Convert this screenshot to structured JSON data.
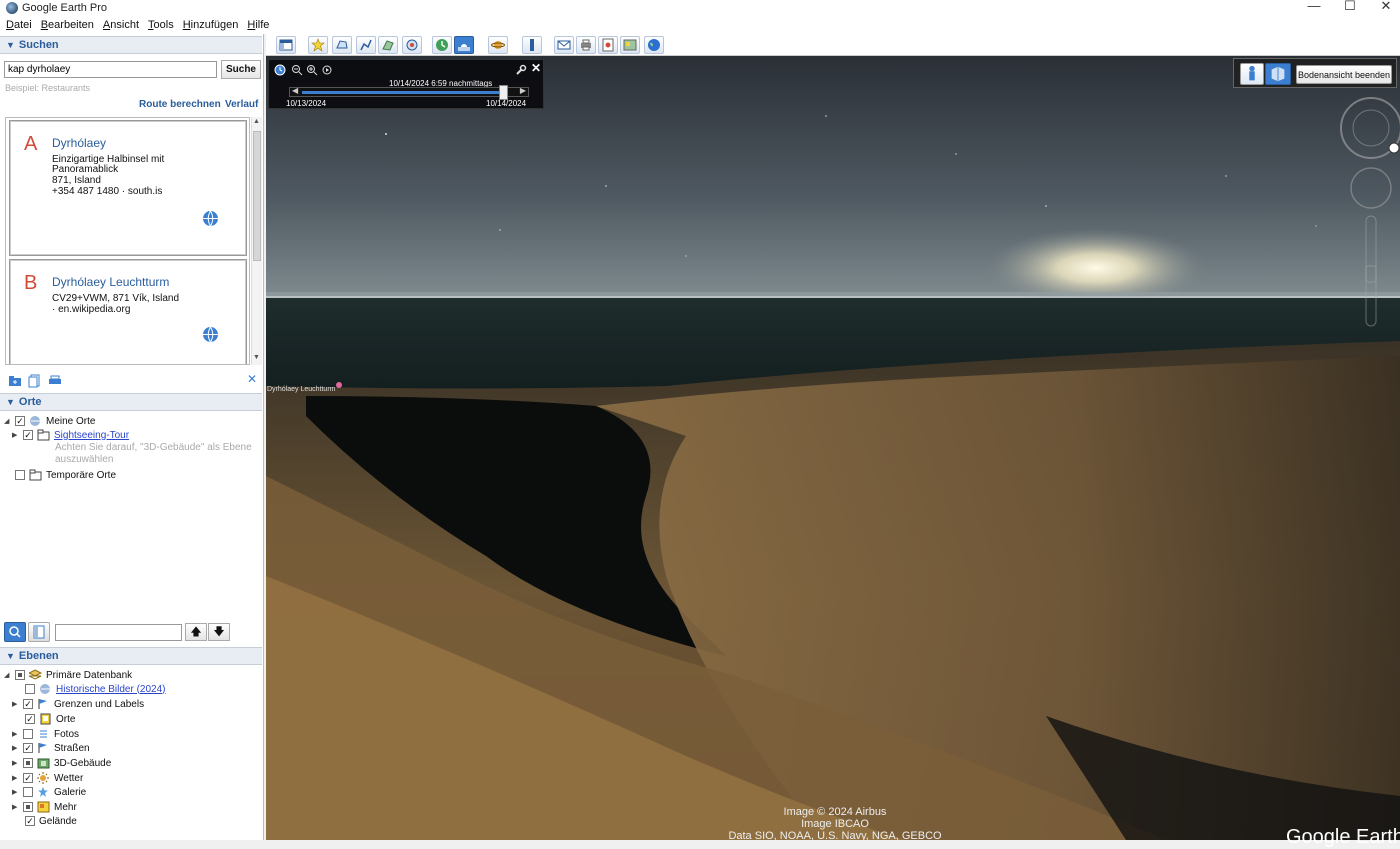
{
  "window": {
    "title": "Google Earth Pro",
    "minimize": "—",
    "maximize": "☐",
    "close": "✕"
  },
  "menu": [
    "Datei",
    "Bearbeiten",
    "Ansicht",
    "Tools",
    "Hinzufügen",
    "Hilfe"
  ],
  "toolbar": {
    "buttons": [
      "sidebar-toggle-icon",
      "placemark-icon",
      "polygon-icon",
      "path-icon",
      "image-overlay-icon",
      "record-tour-icon",
      "historical-imagery-icon",
      "sunlight-icon",
      "planets-icon",
      "ruler-icon",
      "email-icon",
      "print-icon",
      "save-image-icon",
      "google-maps-icon",
      "earth-icon"
    ]
  },
  "search": {
    "header": "Suchen",
    "query": "kap dyrholaey",
    "button": "Suche",
    "example": "Beispiel: Restaurants",
    "route_link": "Route berechnen",
    "history_link": "Verlauf",
    "results": [
      {
        "letter": "A",
        "name": "Dyrhólaey",
        "lines": [
          "Einzigartige Halbinsel mit",
          "Panoramablick",
          "871, Island",
          "+354 487 1480 · south.is"
        ]
      },
      {
        "letter": "B",
        "name": "Dyrhólaey Leuchtturm",
        "lines": [
          "CV29+VWM, 871 Vík, Island",
          "· en.wikipedia.org"
        ]
      }
    ]
  },
  "places": {
    "header": "Orte",
    "my_places": "Meine Orte",
    "tour": "Sightseeing-Tour",
    "tour_note_1": "Achten Sie darauf, \"3D-Gebäude\" als Ebene",
    "tour_note_2": "auszuwählen",
    "temp": "Temporäre Orte"
  },
  "layers": {
    "header": "Ebenen",
    "primary": "Primäre Datenbank",
    "items": [
      {
        "label": "Historische Bilder (2024)",
        "checked": false,
        "link": true
      },
      {
        "label": "Grenzen und Labels",
        "checked": true
      },
      {
        "label": "Orte",
        "checked": true
      },
      {
        "label": "Fotos",
        "checked": false
      },
      {
        "label": "Straßen",
        "checked": true
      },
      {
        "label": "3D-Gebäude",
        "checked": "partial"
      },
      {
        "label": "Wetter",
        "checked": true
      },
      {
        "label": "Galerie",
        "checked": false
      },
      {
        "label": "Mehr",
        "checked": "partial"
      }
    ],
    "terrain": "Gelände"
  },
  "timeslider": {
    "current": "10/14/2024    6:59 nachmittags",
    "start": "10/13/2024",
    "end": "10/14/2024",
    "position": 0.93
  },
  "map": {
    "place_label": "Dyrhólaey Leuchtturm",
    "end_ground_view": "Bodenansicht beenden",
    "attribution": [
      "Image © 2024 Airbus",
      "Image IBCAO",
      "Data SIO, NOAA, U.S. Navy, NGA, GEBCO"
    ],
    "logo": "Google Earth"
  }
}
